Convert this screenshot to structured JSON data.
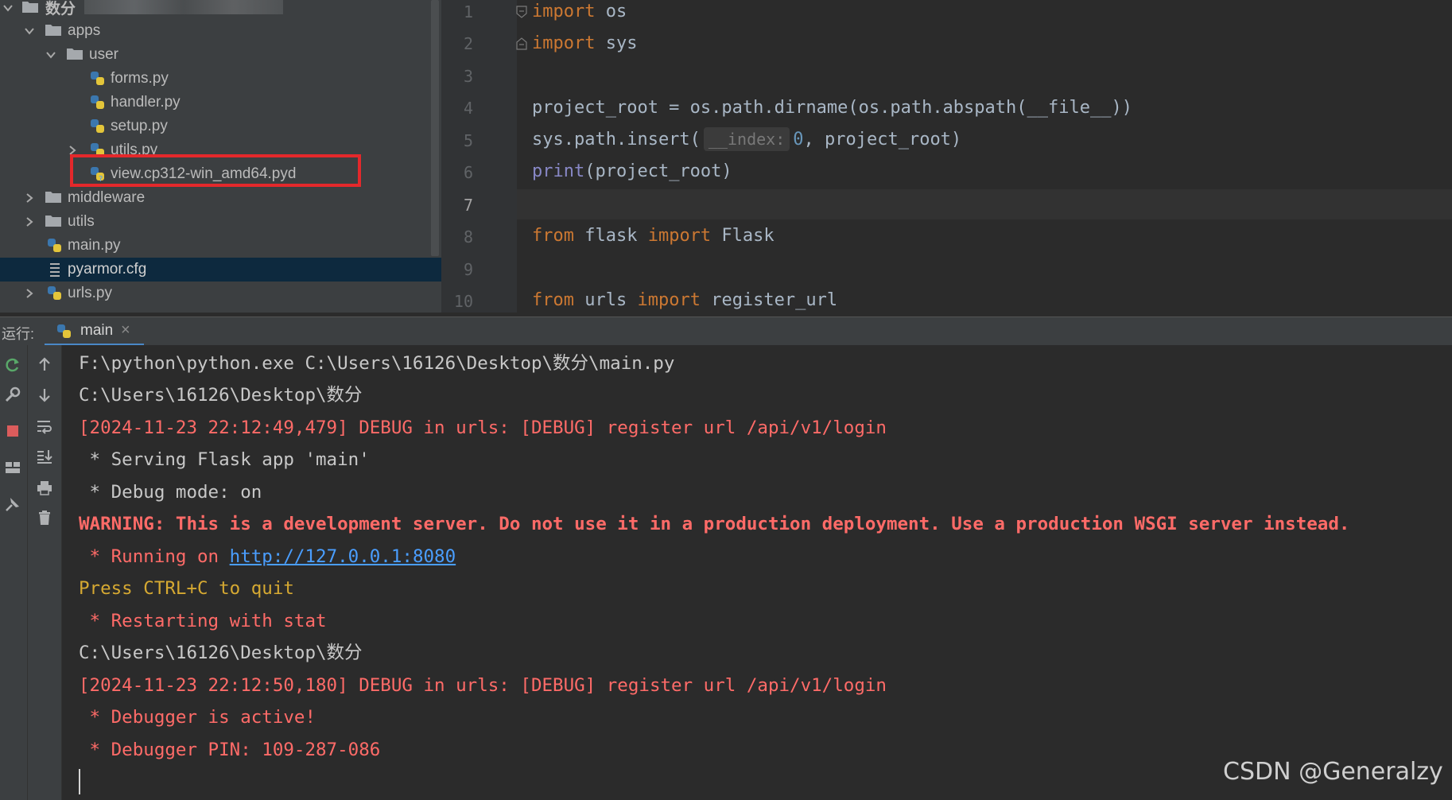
{
  "tree": {
    "items": [
      {
        "label": "数分",
        "kind": "folder",
        "state": "open"
      },
      {
        "label": "apps",
        "kind": "folder",
        "state": "open"
      },
      {
        "label": "user",
        "kind": "folder",
        "state": "open"
      },
      {
        "label": "forms.py",
        "kind": "python-file"
      },
      {
        "label": "handler.py",
        "kind": "python-file"
      },
      {
        "label": "setup.py",
        "kind": "python-file"
      },
      {
        "label": "utils.py",
        "kind": "python-file",
        "state": "closed"
      },
      {
        "label": "view.cp312-win_amd64.pyd",
        "kind": "pyd-file"
      },
      {
        "label": "middleware",
        "kind": "folder",
        "state": "closed"
      },
      {
        "label": "utils",
        "kind": "folder",
        "state": "closed"
      },
      {
        "label": "main.py",
        "kind": "python-file"
      },
      {
        "label": "pyarmor.cfg",
        "kind": "config-file",
        "selected": true
      },
      {
        "label": "urls.py",
        "kind": "python-file",
        "state": "closed"
      }
    ]
  },
  "editor": {
    "line_numbers": [
      "1",
      "2",
      "3",
      "4",
      "5",
      "6",
      "7",
      "8",
      "9",
      "10"
    ],
    "code": {
      "l1_kw": "import",
      "l1_rest": " os",
      "l2_kw": "import",
      "l2_rest": " sys",
      "l4": "project_root = os.path.dirname(os.path.abspath(__file__))",
      "l5_a": "sys.path.insert(",
      "l5_hint": "__index:",
      "l5_num": "0",
      "l5_b": ", project_root)",
      "l6_fn": "print",
      "l6_rest": "(project_root)",
      "l8_kw1": "from",
      "l8_mid": " flask ",
      "l8_kw2": "import",
      "l8_rest": " Flask",
      "l10_kw1": "from",
      "l10_mid": " urls ",
      "l10_kw2": "import",
      "l10_rest": " register_url"
    }
  },
  "run": {
    "label": "运行:",
    "tab_label": "main",
    "tab_close": "×"
  },
  "console": {
    "lines": [
      "F:\\python\\python.exe C:\\Users\\16126\\Desktop\\数分\\main.py",
      "C:\\Users\\16126\\Desktop\\数分",
      "[2024-11-23 22:12:49,479] DEBUG in urls: [DEBUG] register url /api/v1/login",
      " * Serving Flask app 'main'",
      " * Debug mode: on",
      "WARNING: This is a development server. Do not use it in a production deployment. Use a production WSGI server instead.",
      " * Running on ",
      "Press CTRL+C to quit",
      " * Restarting with stat",
      "C:\\Users\\16126\\Desktop\\数分",
      "[2024-11-23 22:12:50,180] DEBUG in urls: [DEBUG] register url /api/v1/login",
      " * Debugger is active!",
      " * Debugger PIN: 109-287-086"
    ],
    "link": "http://127.0.0.1:8080"
  },
  "watermark": "CSDN @Generalzy",
  "colors": {
    "accent": "#4a88c7",
    "error": "#ff6b68",
    "warning_yellow": "#d6a932",
    "highlight_box": "#e4282b"
  }
}
